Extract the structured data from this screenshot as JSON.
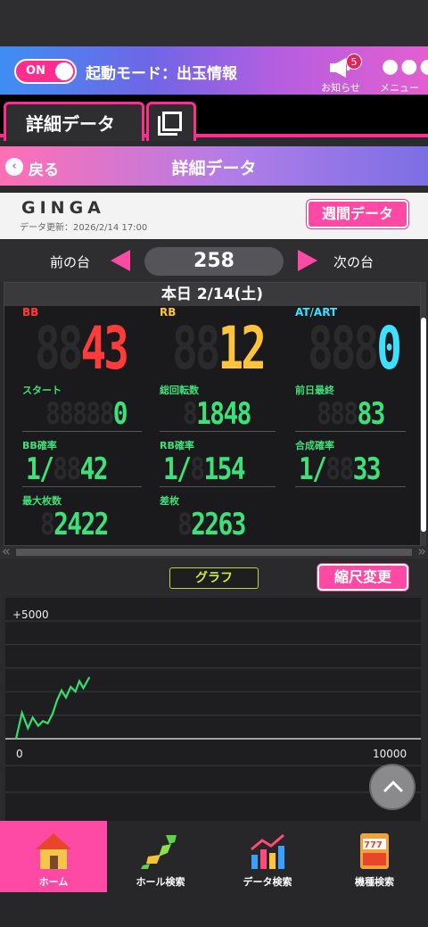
{
  "topbar": {
    "toggle_label": "ON",
    "mode_text": "起動モード：出玉情報",
    "notice_label": "お知らせ",
    "notice_count": "5",
    "menu_label": "メニュー",
    "menu_dots": "●●●"
  },
  "tabs": {
    "active_label": "詳細データ"
  },
  "titlebar": {
    "back_label": "戻る",
    "title": "詳細データ"
  },
  "machine": {
    "name": "GINGA",
    "updated": "データ更新：2026/2/14  17:00",
    "weekly_button": "週間データ"
  },
  "nav": {
    "prev_label": "前の台",
    "number": "258",
    "next_label": "次の台"
  },
  "panel": {
    "date": "本日 2/14(土)",
    "bb": {
      "label": "BB",
      "ghost": "88",
      "value": "43",
      "color": "#ff3b3b"
    },
    "rb": {
      "label": "RB",
      "ghost": "88",
      "value": "12",
      "color": "#ffc43b"
    },
    "at": {
      "label": "AT/ART",
      "ghost": "888",
      "value": "0",
      "color": "#3fe0ff"
    },
    "start": {
      "label": "スタート",
      "ghost": "88888",
      "value": "0"
    },
    "total_spins": {
      "label": "総回転数",
      "ghost": "8",
      "value": "1848"
    },
    "prev_day": {
      "label": "前日最終",
      "ghost": "888",
      "value": "83"
    },
    "bb_prob": {
      "label": "BB確率",
      "prefix": "1/",
      "ghost": "88",
      "value": "42"
    },
    "rb_prob": {
      "label": "RB確率",
      "prefix": "1/",
      "ghost": "8",
      "value": "154"
    },
    "total_prob": {
      "label": "合成確率",
      "prefix": "1/",
      "ghost": "88",
      "value": "33"
    },
    "max_coins": {
      "label": "最大枚数",
      "ghost": "8",
      "value": "2422"
    },
    "diff_coins": {
      "label": "差枚",
      "ghost": "8",
      "value": "2263"
    }
  },
  "graph": {
    "tag": "グラフ",
    "scale_button": "縮尺変更",
    "y_max_label": "+5000",
    "x_min_label": "0",
    "x_max_label": "10000",
    "line_color": "#33e070"
  },
  "chart_data": {
    "type": "line",
    "x": [
      0,
      150,
      300,
      420,
      560,
      680,
      800,
      920,
      1040,
      1150,
      1260,
      1380,
      1500,
      1600,
      1700,
      1848
    ],
    "y": [
      0,
      1100,
      450,
      900,
      550,
      750,
      650,
      1050,
      1650,
      2050,
      1750,
      2200,
      2000,
      2450,
      2150,
      2600
    ],
    "xlim": [
      0,
      10000
    ],
    "ylim": [
      0,
      5000
    ],
    "tick_labels": [
      "+5000",
      "0",
      "10000"
    ]
  },
  "bottom_nav": [
    {
      "label": "ホーム"
    },
    {
      "label": "ホール検索"
    },
    {
      "label": "データ検索"
    },
    {
      "label": "機種検索"
    }
  ]
}
